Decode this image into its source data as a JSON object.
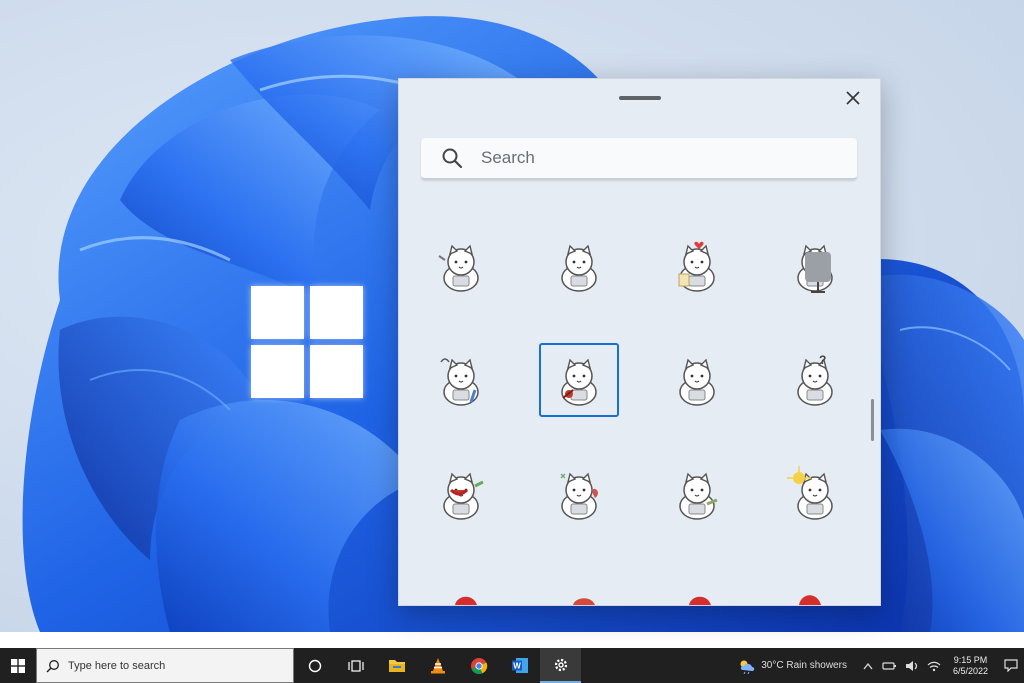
{
  "panel": {
    "search_placeholder": "Search",
    "stickers": [
      {
        "name": "cat-sticker-lying-down"
      },
      {
        "name": "cat-sticker-sitting"
      },
      {
        "name": "cat-sticker-heart"
      },
      {
        "name": "cat-sticker-chair"
      },
      {
        "name": "cat-sticker-music"
      },
      {
        "name": "cat-sticker-dragging",
        "selected": true
      },
      {
        "name": "cat-sticker-front"
      },
      {
        "name": "cat-sticker-question"
      },
      {
        "name": "cat-sticker-shouting"
      },
      {
        "name": "cat-sticker-sleeping"
      },
      {
        "name": "cat-sticker-waving"
      },
      {
        "name": "cat-sticker-sunbathing"
      }
    ]
  },
  "taskbar": {
    "search_placeholder": "Type here to search",
    "weather": "30°C  Rain showers",
    "time": "9:15 PM",
    "date": "6/5/2022"
  },
  "colors": {
    "accent": "#1a6fd1",
    "wallpaper_blue": "#1e5fe0",
    "taskbar": "#202020"
  }
}
